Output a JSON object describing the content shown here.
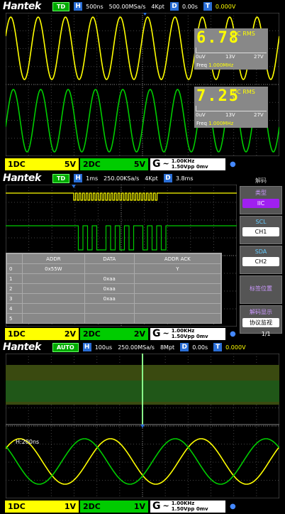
{
  "colors": {
    "ch1": "#ffff00",
    "ch2": "#00cc00",
    "trigger": "#2a6ed6",
    "purple": "#a020f0"
  },
  "panel1": {
    "logo": "Hantek",
    "mode": "TD",
    "h_label": "H",
    "timebase": "500ns",
    "sample_rate": "500.00MSa/s",
    "memory": "4Kpt",
    "d_label": "D",
    "delay": "0.00s",
    "t_label": "T",
    "trigger_level": "0.000V",
    "meas1": {
      "value": "6.78",
      "type": "DC RMS",
      "unit": "V",
      "scale_labels": [
        "0uV",
        "13V",
        "27V"
      ],
      "freq_label": "Freq",
      "freq_value": "1.000MHz"
    },
    "meas2": {
      "value": "7.25",
      "type": "DC RMS",
      "unit": "V",
      "scale_labels": [
        "0uV",
        "13V",
        "27V"
      ],
      "freq_label": "Freq",
      "freq_value": "1.000MHz"
    },
    "ch1": {
      "label": "1DC",
      "scale": "5V"
    },
    "ch2": {
      "label": "2DC",
      "scale": "5V"
    },
    "gen": {
      "g": "G",
      "wave": "~",
      "freq": "1.00KHz",
      "amp": "1.50Vpp",
      "offset": "0mv"
    }
  },
  "panel2": {
    "logo": "Hantek",
    "mode": "TD",
    "h_label": "H",
    "timebase": "1ms",
    "sample_rate": "250.00KSa/s",
    "memory": "4Kpt",
    "d_label": "D",
    "delay": "3.8ms",
    "menu_title": "解码",
    "menu": [
      {
        "label": "类型",
        "value": "IIC"
      },
      {
        "label": "SCL",
        "value": "CH1"
      },
      {
        "label": "SDA",
        "value": "CH2"
      },
      {
        "label": "标签位置",
        "value": ""
      },
      {
        "label": "解码显示",
        "value": "协议监视"
      }
    ],
    "page": "1/1",
    "table": {
      "headers": [
        "",
        "ADDR",
        "DATA",
        "ADDR ACK"
      ],
      "rows": [
        [
          "0",
          "0x55W",
          "",
          "Y"
        ],
        [
          "1",
          "",
          "0xaa",
          ""
        ],
        [
          "2",
          "",
          "0xaa",
          ""
        ],
        [
          "3",
          "",
          "0xaa",
          ""
        ],
        [
          "4",
          "",
          "",
          ""
        ],
        [
          "5",
          "",
          "",
          ""
        ]
      ]
    },
    "ch1": {
      "label": "1DC",
      "scale": "2V"
    },
    "ch2": {
      "label": "2DC",
      "scale": "2V"
    },
    "gen": {
      "g": "G",
      "wave": "~",
      "freq": "1.00KHz",
      "amp": "1.50Vpp",
      "offset": "0mv"
    }
  },
  "panel3": {
    "logo": "Hantek",
    "mode": "AUTO",
    "h_label": "H",
    "timebase": "100us",
    "sample_rate": "250.00MSa/s",
    "memory": "8Mpt",
    "d_label": "D",
    "delay": "0.00s",
    "t_label": "T",
    "trigger_level": "0.000V",
    "zoom_label": "H:200ns",
    "ch1": {
      "label": "1DC",
      "scale": "1V"
    },
    "ch2": {
      "label": "2DC",
      "scale": "1V"
    },
    "gen": {
      "g": "G",
      "wave": "~",
      "freq": "1.00KHz",
      "amp": "1.50Vpp",
      "offset": "0mv"
    }
  }
}
